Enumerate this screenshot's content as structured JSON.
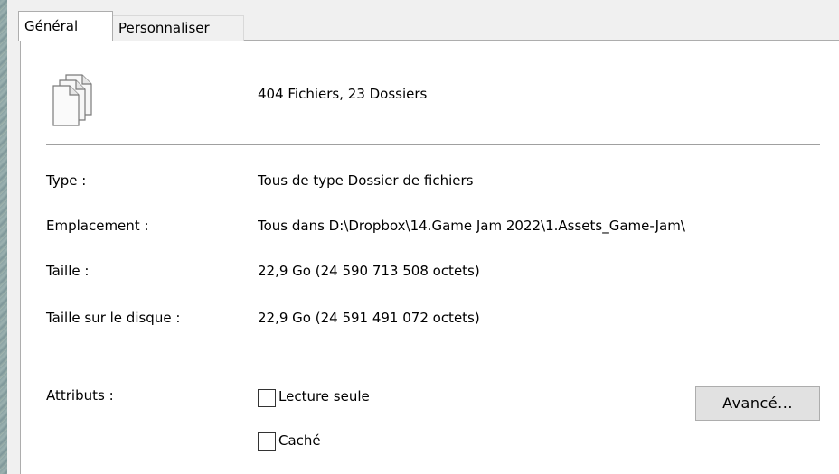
{
  "tabs": [
    {
      "label": "Général",
      "active": true
    },
    {
      "label": "Personnaliser",
      "active": false
    }
  ],
  "summary": {
    "icon": "files-stack-icon",
    "text": "404 Fichiers, 23 Dossiers"
  },
  "details": [
    {
      "label": "Type :",
      "value": "Tous de type Dossier de fichiers"
    },
    {
      "label": "Emplacement :",
      "value": "Tous dans D:\\Dropbox\\14.Game Jam 2022\\1.Assets_Game-Jam\\"
    },
    {
      "label": "Taille :",
      "value": "22,9 Go (24 590 713 508 octets)"
    },
    {
      "label": "Taille sur le disque :",
      "value": "22,9 Go (24 591 491 072 octets)"
    }
  ],
  "attributes": {
    "label": "Attributs :",
    "read_only": {
      "label": "Lecture seule",
      "checked": false
    },
    "hidden": {
      "label": "Caché",
      "checked": false
    },
    "advanced_button": "Avancé..."
  }
}
